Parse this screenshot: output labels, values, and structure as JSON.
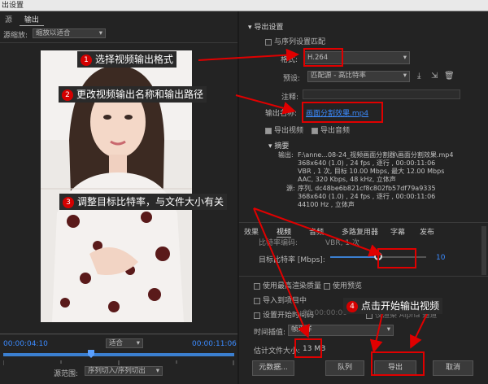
{
  "title": "出设置",
  "left_tabs": [
    "源",
    "输出"
  ],
  "source_scale": {
    "label": "源缩放:",
    "value": "缩放以适合"
  },
  "timeline": {
    "current_time": "00:00:04:10",
    "fit": "适合",
    "end_time": "00:00:11:06"
  },
  "source_range": {
    "label": "源范围:",
    "value": "序列切入/序列切出"
  },
  "export_settings": {
    "header": "导出设置",
    "match_sequence": "与序列设置匹配",
    "format_label": "格式:",
    "format_value": "H.264",
    "preset_label": "预设:",
    "preset_value": "匹配源 - 高比特率",
    "comments_label": "注释:",
    "output_name_label": "输出名称:",
    "output_name_value": "画面分割效果.mp4",
    "export_video": "导出视频",
    "export_audio": "导出音频"
  },
  "summary": {
    "header": "摘要",
    "output_label": "输出:",
    "output_lines": [
      "F:\\anne...08-24_视频画面分割器\\画面分割效果.mp4",
      "368x640 (1.0) , 24 fps , 逐行 , 00:00:11:06",
      "VBR , 1 次, 目标 10.00 Mbps, 最大 12.00 Mbps",
      "AAC, 320 Kbps, 48 kHz, 立体声"
    ],
    "source_label": "源:",
    "source_lines": [
      "序列, dc48be6b821cf8c802fb57df79a9335",
      "368x640 (1.0) , 24 fps , 逐行 , 00:00:11:06",
      "44100 Hz , 立体声"
    ]
  },
  "bottom_tabs": [
    "效果",
    "视频",
    "音频",
    "多路复用器",
    "字幕",
    "发布"
  ],
  "bitrate": {
    "top_label": "比特率编码:",
    "top_value": "VBR, 1 次",
    "label": "目标比特率 [Mbps]:",
    "value": "10",
    "level": 0.5
  },
  "options": {
    "max_render": "使用最高渲染质量",
    "use_previews": "使用预览",
    "import_project": "导入到项目中",
    "set_start_timecode": "设置开始时间码",
    "timecode": "00:00:00:00",
    "render_alpha": "仅渲染 Alpha 通道",
    "time_interp_label": "时间插值:",
    "time_interp_value": "帧采样",
    "est_size_label": "估计文件大小:",
    "est_size_value": "13 MB"
  },
  "buttons": {
    "metadata": "元数据...",
    "queue": "队列",
    "export": "导出",
    "cancel": "取消"
  },
  "annotations": {
    "a1": {
      "num": "1",
      "text": "选择视频输出格式"
    },
    "a2": {
      "num": "2",
      "text": "更改视频输出名称和输出路径"
    },
    "a3": {
      "num": "3",
      "text": "调整目标比特率，与文件大小有关"
    },
    "a4": {
      "num": "4",
      "text": "点击开始输出视频"
    }
  },
  "colors": {
    "annotation_red": "#e00000",
    "link_blue": "#3b8bff",
    "slider_blue": "#3b7fd0"
  }
}
